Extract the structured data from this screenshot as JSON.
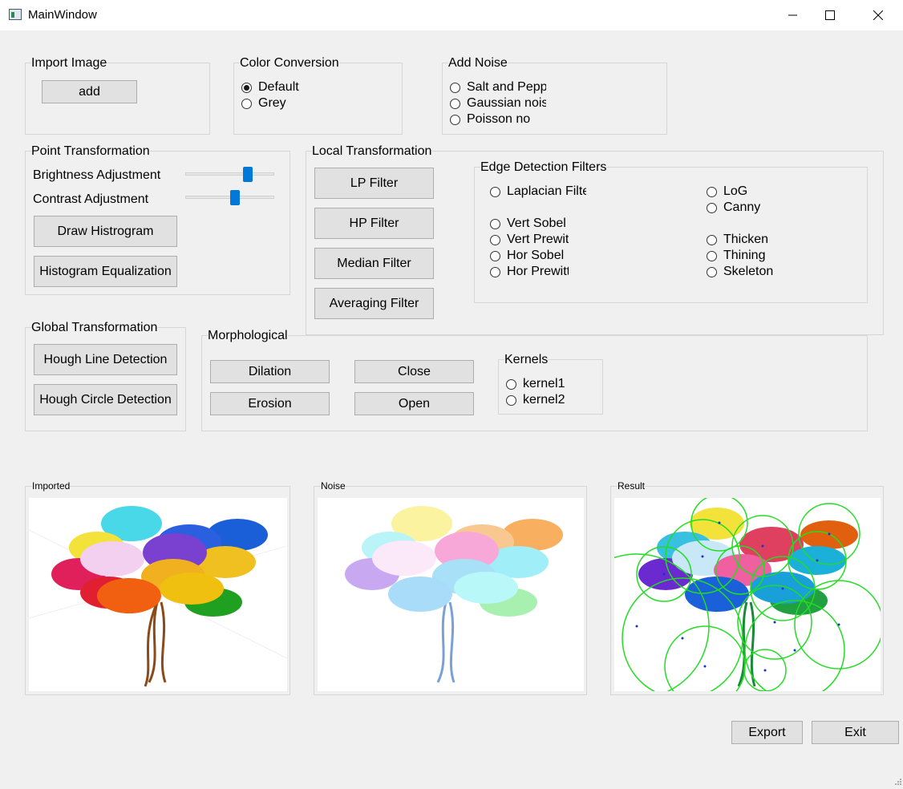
{
  "window": {
    "title": "MainWindow",
    "minimize": "—",
    "maximize": "☐",
    "close": "✕"
  },
  "import_image": {
    "title": "Import Image",
    "add_label": "add"
  },
  "color_conversion": {
    "title": "Color Conversion",
    "default_label": "Default",
    "grey_label": "Grey",
    "selected": "Default"
  },
  "add_noise": {
    "title": "Add Noise",
    "options": [
      "Salt and Pepper",
      "Gaussian noise",
      "Poisson noise"
    ]
  },
  "point_transformation": {
    "title": "Point Transformation",
    "brightness_label": "Brightness Adjustment",
    "brightness_value": 0.73,
    "contrast_label": "Contrast Adjustment",
    "contrast_value": 0.57,
    "draw_histogram_label": "Draw Histrogram",
    "histogram_eq_label": "Histogram Equalization"
  },
  "local_transformation": {
    "title": "Local Transformation",
    "lp_label": "LP Filter",
    "hp_label": "HP Filter",
    "median_label": "Median Filter",
    "averaging_label": "Averaging Filter"
  },
  "edge_detection": {
    "title": "Edge Detection Filters",
    "laplacian": "Laplacian Filter",
    "vert_sobel": "Vert Sobel",
    "vert_prewitt": "Vert Prewitt",
    "hor_sobel": "Hor Sobel",
    "hor_prewitt": "Hor Prewitt",
    "log": "LoG",
    "canny": "Canny",
    "thicken": "Thicken",
    "thining": "Thining",
    "skeleton": "Skeleton"
  },
  "global_transformation": {
    "title": "Global Transformation",
    "hough_line_label": "Hough Line Detection",
    "hough_circle_label": "Hough Circle Detection"
  },
  "morphological": {
    "title": "Morphological",
    "dilation_label": "Dilation",
    "close_label": "Close",
    "erosion_label": "Erosion",
    "open_label": "Open",
    "kernels_title": "Kernels",
    "kernel1": "kernel1",
    "kernel2": "kernel2"
  },
  "images": {
    "imported_title": "Imported",
    "noise_title": "Noise",
    "result_title": "Result"
  },
  "footer": {
    "export_label": "Export",
    "exit_label": "Exit"
  },
  "colors": {
    "accent": "#0078d7",
    "circle_green": "#22dd22"
  }
}
